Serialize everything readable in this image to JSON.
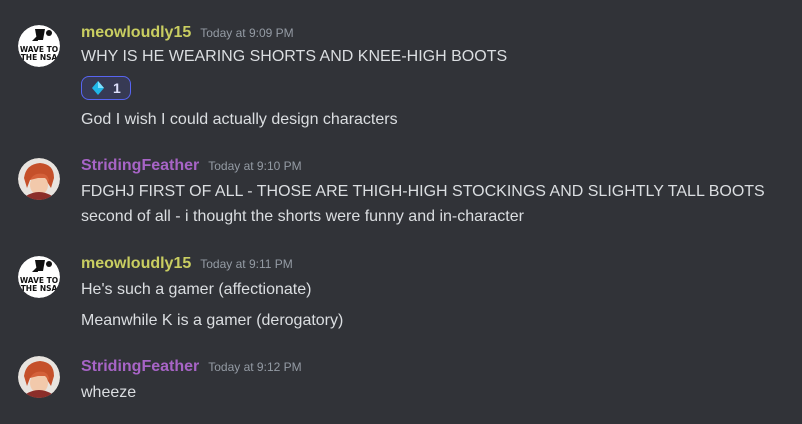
{
  "colors": {
    "background": "#313338",
    "meowloudly_name": "#c9ce61",
    "stridingfeather_name": "#a764c6",
    "timestamp": "#949ba4",
    "message_text": "#dbdee1",
    "reaction_border": "#5865f2"
  },
  "groups": [
    {
      "author": "meowloudly15",
      "avatar": "wave-to-the-nsa-avatar",
      "avatar_text": [
        "WAVE TO",
        "THE NSA"
      ],
      "timestamp": "Today at 9:09 PM",
      "messages": [
        "WHY IS HE WEARING SHORTS AND KNEE-HIGH BOOTS",
        "God I wish I could actually design characters"
      ],
      "reaction": {
        "emoji": "diamond-icon",
        "count": "1"
      }
    },
    {
      "author": "StridingFeather",
      "avatar": "anime-character-avatar",
      "timestamp": "Today at 9:10 PM",
      "messages": [
        "FDGHJ FIRST OF ALL - THOSE ARE THIGH-HIGH STOCKINGS AND SLIGHTLY TALL BOOTS",
        "second of all - i thought the shorts were funny and in-character"
      ]
    },
    {
      "author": "meowloudly15",
      "avatar": "wave-to-the-nsa-avatar",
      "avatar_text": [
        "WAVE TO",
        "THE NSA"
      ],
      "timestamp": "Today at 9:11 PM",
      "messages": [
        "He's such a gamer (affectionate)",
        "Meanwhile K is a gamer (derogatory)"
      ]
    },
    {
      "author": "StridingFeather",
      "avatar": "anime-character-avatar",
      "timestamp": "Today at 9:12 PM",
      "messages": [
        "wheeze"
      ]
    }
  ]
}
